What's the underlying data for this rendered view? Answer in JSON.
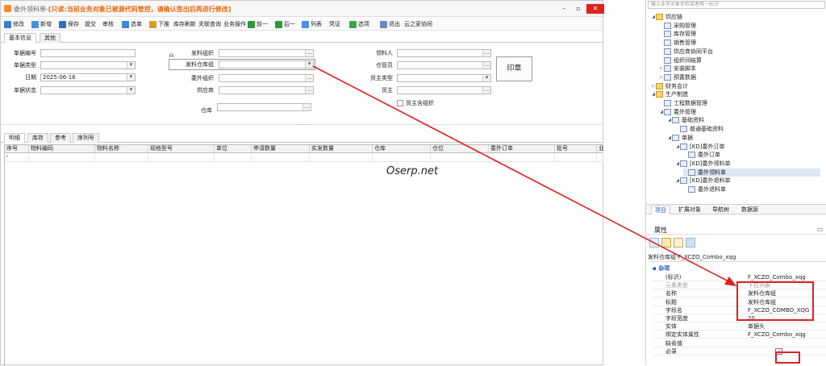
{
  "window": {
    "title": "委外领料单",
    "warning": "[只读:当前业务对象已被源代码管控，请确认签出后再进行修改]",
    "controls": {
      "min": "–",
      "max": "▫",
      "close": "✕"
    }
  },
  "toolbar": [
    {
      "label": "修改",
      "icon": "edit-icon",
      "color": "#3b7fd4"
    },
    {
      "label": "新增",
      "icon": "new-doc-icon",
      "color": "#4a8fe0"
    },
    {
      "label": "保存",
      "icon": "save-icon",
      "color": "#2f6fbf"
    },
    {
      "label": "提交",
      "icon": "",
      "color": ""
    },
    {
      "label": "审核",
      "icon": "",
      "color": ""
    },
    {
      "label": "选单",
      "icon": "select-icon",
      "color": "#3a86d8"
    },
    {
      "label": "下推",
      "icon": "push-icon",
      "color": "#d8a020"
    },
    {
      "label": "库存刷新",
      "icon": "",
      "color": ""
    },
    {
      "label": "关联查询",
      "icon": "",
      "color": ""
    },
    {
      "label": "业务操作",
      "icon": "",
      "color": ""
    },
    {
      "label": "前一",
      "icon": "arrow-left-icon",
      "color": "#2a9a3a"
    },
    {
      "label": "后一",
      "icon": "arrow-right-icon",
      "color": "#2a9a3a"
    },
    {
      "label": "列表",
      "icon": "list-icon",
      "color": "#4a8fe0"
    },
    {
      "label": "凭证",
      "icon": "",
      "color": ""
    },
    {
      "label": "选项",
      "icon": "options-icon",
      "color": "#3aa54a"
    },
    {
      "label": "退出",
      "icon": "exit-icon",
      "color": "#6a8ac0"
    },
    {
      "label": "云之家协同",
      "icon": "",
      "color": ""
    }
  ],
  "head_tabs": [
    "基本信息",
    "其他"
  ],
  "form": {
    "bill_no_label": "单据编号",
    "bill_no": "",
    "bill_type_label": "单据类型",
    "bill_type": "",
    "date_label": "日期",
    "date": "2025-06-16",
    "status_label": "单据状态",
    "status": "",
    "issue_org_label": "发料组织",
    "issue_org": "",
    "issue_stock_group_label": "发料仓库组",
    "issue_stock_group": "",
    "sub_org_label": "委外组织",
    "sub_org": "",
    "supplier_label": "供应商",
    "supplier": "",
    "stock_label": "仓库",
    "stock": "",
    "picker_label": "领料人",
    "picker": "",
    "stock_keeper_label": "仓管员",
    "stock_keeper": "",
    "owner_type_label": "货主类型",
    "owner_type": "",
    "owner_label": "货主",
    "owner": "",
    "owner_org_label": "货主含组织",
    "stamp": "印章"
  },
  "detail_tabs": [
    "明细",
    "库存",
    "参考",
    "序列号"
  ],
  "grid_columns": [
    "序号",
    "物料编码",
    "物料名称",
    "规格型号",
    "单位",
    "申请数量",
    "实发数量",
    "仓库",
    "仓位",
    "委外订单",
    "批号",
    "业"
  ],
  "watermark": "Oserp.net",
  "right_panel": {
    "search_placeholder": "输入业务对象名称或者唯一标识",
    "tree": [
      {
        "label": "供应链",
        "level": 1,
        "exp": "◢",
        "folder": true
      },
      {
        "label": "采购管理",
        "level": 2,
        "exp": "",
        "folder": false
      },
      {
        "label": "库存管理",
        "level": 2,
        "exp": "",
        "folder": false
      },
      {
        "label": "销售管理",
        "level": 2,
        "exp": "",
        "folder": false
      },
      {
        "label": "供应商协同平台",
        "level": 2,
        "exp": "",
        "folder": false
      },
      {
        "label": "组织间结算",
        "level": 2,
        "exp": "",
        "folder": false
      },
      {
        "label": "安装脚本",
        "level": 2,
        "exp": "▷",
        "folder": false
      },
      {
        "label": "预置数据",
        "level": 2,
        "exp": "▷",
        "folder": false
      },
      {
        "label": "财务会计",
        "level": 1,
        "exp": "▷",
        "folder": true
      },
      {
        "label": "生产制造",
        "level": 1,
        "exp": "◢",
        "folder": true
      },
      {
        "label": "工程数据管理",
        "level": 2,
        "exp": "",
        "folder": false
      },
      {
        "label": "委外管理",
        "level": 2,
        "exp": "◢",
        "folder": false
      },
      {
        "label": "基础资料",
        "level": 3,
        "exp": "◢",
        "folder": false
      },
      {
        "label": "普通基础资料",
        "level": 4,
        "exp": "",
        "folder": false
      },
      {
        "label": "单据",
        "level": 3,
        "exp": "◢",
        "folder": false
      },
      {
        "label": "[KD]委外订单",
        "level": 4,
        "exp": "◢",
        "folder": false
      },
      {
        "label": "委外订单",
        "level": 5,
        "exp": "",
        "folder": false
      },
      {
        "label": "[KD]委外领料单",
        "level": 4,
        "exp": "◢",
        "folder": false
      },
      {
        "label": "委外领料单",
        "level": 5,
        "exp": "",
        "folder": false,
        "selected": true
      },
      {
        "label": "[KD]委外退料单",
        "level": 4,
        "exp": "◢",
        "folder": false
      },
      {
        "label": "委外退料单",
        "level": 5,
        "exp": "",
        "folder": false
      }
    ],
    "tabs": [
      "项目",
      "扩展对象",
      "导航树",
      "数据源"
    ],
    "props_title": "属性",
    "props_pin": "▭",
    "prop_object": "发料仓库组-F_XCZO_Combo_xqg",
    "category": "杂项",
    "rows": [
      {
        "k": "(标识)",
        "v": "F_XCZO_Combo_xqg",
        "gray": false
      },
      {
        "k": "元素类型",
        "v": "下拉列表",
        "gray": true
      },
      {
        "k": "名称",
        "v": "发料仓库组",
        "gray": false
      },
      {
        "k": "标题",
        "v": "发料仓库组",
        "gray": false
      },
      {
        "k": "字段名",
        "v": "F_XCZO_COMBO_XQG",
        "gray": false
      },
      {
        "k": "字段宽度",
        "v": "20",
        "gray": false
      },
      {
        "k": "实体",
        "v": "单据头",
        "gray": false
      },
      {
        "k": "绑定实体属性",
        "v": "F_XCZO_Combo_xqg",
        "gray": false
      },
      {
        "k": "缺省值",
        "v": "",
        "gray": false
      },
      {
        "k": "必录",
        "v": "✓",
        "gray": false
      }
    ]
  },
  "colors": {
    "warning": "#e86a0a",
    "annotation": "#e02020",
    "tab_active": "#1a55c0"
  }
}
